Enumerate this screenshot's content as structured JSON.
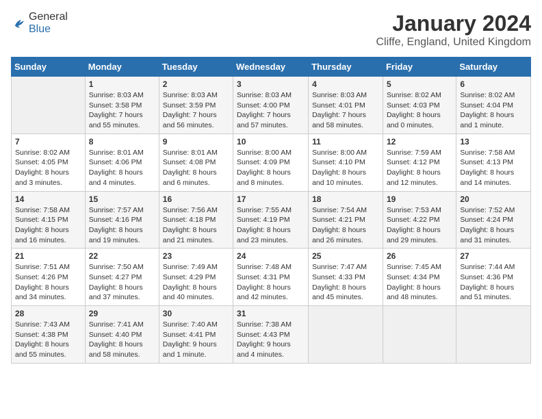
{
  "header": {
    "logo_general": "General",
    "logo_blue": "Blue",
    "month_title": "January 2024",
    "location": "Cliffe, England, United Kingdom"
  },
  "days_of_week": [
    "Sunday",
    "Monday",
    "Tuesday",
    "Wednesday",
    "Thursday",
    "Friday",
    "Saturday"
  ],
  "weeks": [
    [
      {
        "day": "",
        "info": ""
      },
      {
        "day": "1",
        "info": "Sunrise: 8:03 AM\nSunset: 3:58 PM\nDaylight: 7 hours\nand 55 minutes."
      },
      {
        "day": "2",
        "info": "Sunrise: 8:03 AM\nSunset: 3:59 PM\nDaylight: 7 hours\nand 56 minutes."
      },
      {
        "day": "3",
        "info": "Sunrise: 8:03 AM\nSunset: 4:00 PM\nDaylight: 7 hours\nand 57 minutes."
      },
      {
        "day": "4",
        "info": "Sunrise: 8:03 AM\nSunset: 4:01 PM\nDaylight: 7 hours\nand 58 minutes."
      },
      {
        "day": "5",
        "info": "Sunrise: 8:02 AM\nSunset: 4:03 PM\nDaylight: 8 hours\nand 0 minutes."
      },
      {
        "day": "6",
        "info": "Sunrise: 8:02 AM\nSunset: 4:04 PM\nDaylight: 8 hours\nand 1 minute."
      }
    ],
    [
      {
        "day": "7",
        "info": "Sunrise: 8:02 AM\nSunset: 4:05 PM\nDaylight: 8 hours\nand 3 minutes."
      },
      {
        "day": "8",
        "info": "Sunrise: 8:01 AM\nSunset: 4:06 PM\nDaylight: 8 hours\nand 4 minutes."
      },
      {
        "day": "9",
        "info": "Sunrise: 8:01 AM\nSunset: 4:08 PM\nDaylight: 8 hours\nand 6 minutes."
      },
      {
        "day": "10",
        "info": "Sunrise: 8:00 AM\nSunset: 4:09 PM\nDaylight: 8 hours\nand 8 minutes."
      },
      {
        "day": "11",
        "info": "Sunrise: 8:00 AM\nSunset: 4:10 PM\nDaylight: 8 hours\nand 10 minutes."
      },
      {
        "day": "12",
        "info": "Sunrise: 7:59 AM\nSunset: 4:12 PM\nDaylight: 8 hours\nand 12 minutes."
      },
      {
        "day": "13",
        "info": "Sunrise: 7:58 AM\nSunset: 4:13 PM\nDaylight: 8 hours\nand 14 minutes."
      }
    ],
    [
      {
        "day": "14",
        "info": "Sunrise: 7:58 AM\nSunset: 4:15 PM\nDaylight: 8 hours\nand 16 minutes."
      },
      {
        "day": "15",
        "info": "Sunrise: 7:57 AM\nSunset: 4:16 PM\nDaylight: 8 hours\nand 19 minutes."
      },
      {
        "day": "16",
        "info": "Sunrise: 7:56 AM\nSunset: 4:18 PM\nDaylight: 8 hours\nand 21 minutes."
      },
      {
        "day": "17",
        "info": "Sunrise: 7:55 AM\nSunset: 4:19 PM\nDaylight: 8 hours\nand 23 minutes."
      },
      {
        "day": "18",
        "info": "Sunrise: 7:54 AM\nSunset: 4:21 PM\nDaylight: 8 hours\nand 26 minutes."
      },
      {
        "day": "19",
        "info": "Sunrise: 7:53 AM\nSunset: 4:22 PM\nDaylight: 8 hours\nand 29 minutes."
      },
      {
        "day": "20",
        "info": "Sunrise: 7:52 AM\nSunset: 4:24 PM\nDaylight: 8 hours\nand 31 minutes."
      }
    ],
    [
      {
        "day": "21",
        "info": "Sunrise: 7:51 AM\nSunset: 4:26 PM\nDaylight: 8 hours\nand 34 minutes."
      },
      {
        "day": "22",
        "info": "Sunrise: 7:50 AM\nSunset: 4:27 PM\nDaylight: 8 hours\nand 37 minutes."
      },
      {
        "day": "23",
        "info": "Sunrise: 7:49 AM\nSunset: 4:29 PM\nDaylight: 8 hours\nand 40 minutes."
      },
      {
        "day": "24",
        "info": "Sunrise: 7:48 AM\nSunset: 4:31 PM\nDaylight: 8 hours\nand 42 minutes."
      },
      {
        "day": "25",
        "info": "Sunrise: 7:47 AM\nSunset: 4:33 PM\nDaylight: 8 hours\nand 45 minutes."
      },
      {
        "day": "26",
        "info": "Sunrise: 7:45 AM\nSunset: 4:34 PM\nDaylight: 8 hours\nand 48 minutes."
      },
      {
        "day": "27",
        "info": "Sunrise: 7:44 AM\nSunset: 4:36 PM\nDaylight: 8 hours\nand 51 minutes."
      }
    ],
    [
      {
        "day": "28",
        "info": "Sunrise: 7:43 AM\nSunset: 4:38 PM\nDaylight: 8 hours\nand 55 minutes."
      },
      {
        "day": "29",
        "info": "Sunrise: 7:41 AM\nSunset: 4:40 PM\nDaylight: 8 hours\nand 58 minutes."
      },
      {
        "day": "30",
        "info": "Sunrise: 7:40 AM\nSunset: 4:41 PM\nDaylight: 9 hours\nand 1 minute."
      },
      {
        "day": "31",
        "info": "Sunrise: 7:38 AM\nSunset: 4:43 PM\nDaylight: 9 hours\nand 4 minutes."
      },
      {
        "day": "",
        "info": ""
      },
      {
        "day": "",
        "info": ""
      },
      {
        "day": "",
        "info": ""
      }
    ]
  ]
}
